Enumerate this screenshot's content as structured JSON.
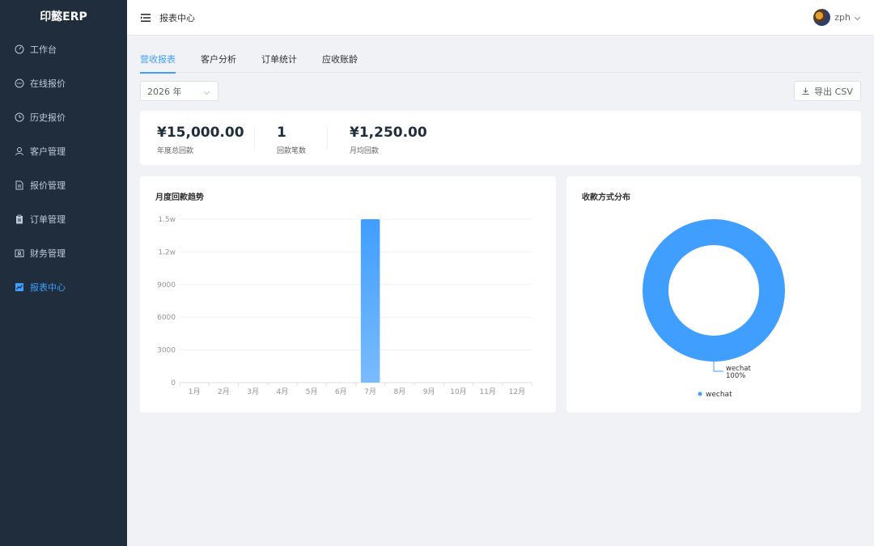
{
  "app": {
    "title": "印懿ERP"
  },
  "sidebar": {
    "items": [
      {
        "label": "工作台",
        "icon": "dashboard-icon"
      },
      {
        "label": "在线报价",
        "icon": "chat-icon"
      },
      {
        "label": "历史报价",
        "icon": "clock-icon"
      },
      {
        "label": "客户管理",
        "icon": "user-icon"
      },
      {
        "label": "报价管理",
        "icon": "document-icon"
      },
      {
        "label": "订单管理",
        "icon": "clipboard-icon"
      },
      {
        "label": "财务管理",
        "icon": "wallet-icon"
      },
      {
        "label": "报表中心",
        "icon": "chart-icon",
        "active": true
      }
    ]
  },
  "header": {
    "breadcrumb": "报表中心",
    "username": "zph"
  },
  "tabs": [
    {
      "label": "营收报表",
      "active": true
    },
    {
      "label": "客户分析"
    },
    {
      "label": "订单统计"
    },
    {
      "label": "应收账龄"
    }
  ],
  "filters": {
    "year": "2026 年",
    "export_label": "导出 CSV"
  },
  "stats": [
    {
      "value": "¥15,000.00",
      "label": "年度总回款"
    },
    {
      "value": "1",
      "label": "回款笔数"
    },
    {
      "value": "¥1,250.00",
      "label": "月均回款"
    }
  ],
  "colors": {
    "accent": "#409eff",
    "sidebar_bg": "#1f2d3d"
  },
  "charts": {
    "monthly_title": "月度回款趋势",
    "payment_title": "收款方式分布"
  },
  "chart_data": [
    {
      "type": "bar",
      "title": "月度回款趋势",
      "categories": [
        "1月",
        "2月",
        "3月",
        "4月",
        "5月",
        "6月",
        "7月",
        "8月",
        "9月",
        "10月",
        "11月",
        "12月"
      ],
      "values": [
        0,
        0,
        0,
        0,
        0,
        0,
        15000,
        0,
        0,
        0,
        0,
        0
      ],
      "ylim": [
        0,
        15000
      ],
      "yticks": [
        0,
        3000,
        6000,
        9000,
        12000,
        15000
      ],
      "ytick_labels": [
        "0",
        "3000",
        "6000",
        "9000",
        "1.2w",
        "1.5w"
      ],
      "grid": true
    },
    {
      "type": "pie",
      "title": "收款方式分布",
      "labels": [
        "wechat"
      ],
      "values": [
        100
      ],
      "data_labels": [
        "100%"
      ],
      "legend": "bottom",
      "donut": true
    }
  ]
}
